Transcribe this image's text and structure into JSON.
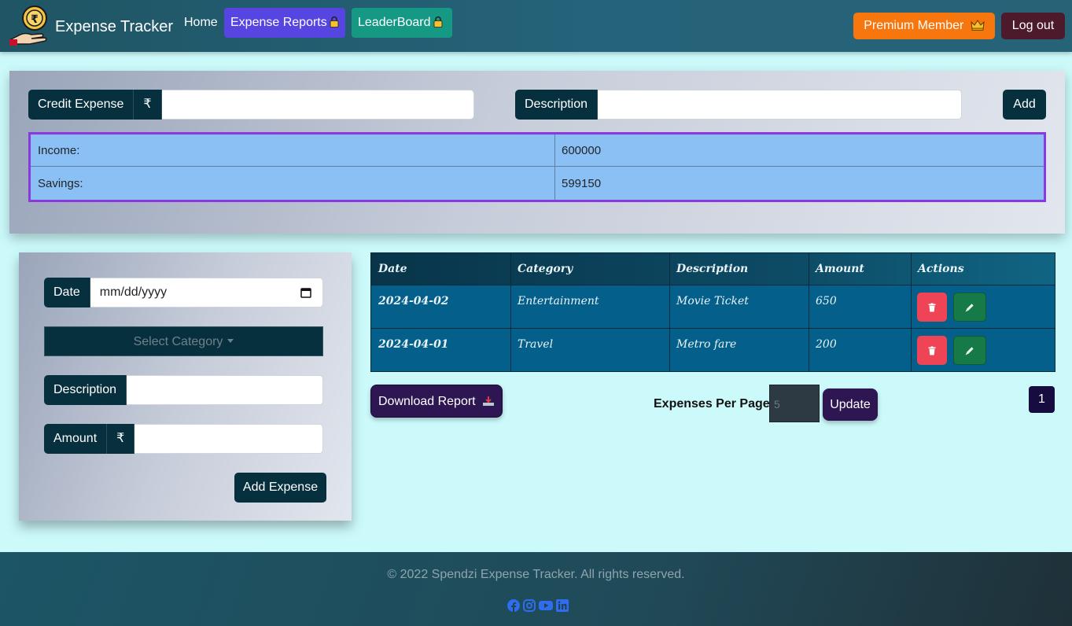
{
  "navbar": {
    "brand": "Expense Tracker",
    "links": {
      "home": "Home",
      "reports": "Expense Reports",
      "leaderboard": "LeaderBoard"
    },
    "premium": "Premium Member",
    "logout": "Log out"
  },
  "credit": {
    "amount_label": "Credit Expense",
    "currency": "₹",
    "description_label": "Description",
    "add_label": "Add"
  },
  "summary": {
    "rows": [
      {
        "label": "Income:",
        "value": "600000"
      },
      {
        "label": "Savings:",
        "value": "599150"
      }
    ]
  },
  "expense_form": {
    "date_label": "Date",
    "date_placeholder": "mm/dd/yyyy",
    "category_placeholder": "Select Category",
    "description_label": "Description",
    "amount_label": "Amount",
    "currency": "₹",
    "submit_label": "Add Expense"
  },
  "expenses_table": {
    "headers": [
      "Date",
      "Category",
      "Description",
      "Amount",
      "Actions"
    ],
    "rows": [
      {
        "date": "2024-04-02",
        "category": "Entertainment",
        "description": "Movie Ticket",
        "amount": "650"
      },
      {
        "date": "2024-04-01",
        "category": "Travel",
        "description": "Metro fare",
        "amount": "200"
      }
    ]
  },
  "controls": {
    "download_label": "Download Report",
    "per_page_label": "Expenses Per Page:",
    "per_page_placeholder": "5",
    "update_label": "Update",
    "current_page": "1"
  },
  "footer": {
    "copyright": "© 2022 Spendzi Expense Tracker. All rights reserved.",
    "social_icons": [
      "facebook-icon",
      "instagram-icon",
      "youtube-icon",
      "linkedin-icon"
    ],
    "social_color": "#2f6cf0"
  },
  "colors": {
    "page_bg": "#ccfafb",
    "dark_teal": "#07303f",
    "premium_orange": "#f8760e",
    "reports_purple": "#5645e0",
    "leaderboard_teal": "#159984",
    "summary_blue": "#8bc0f5",
    "summary_border": "#8a38e0",
    "delete_red": "#ee4455",
    "edit_green": "#157a47"
  }
}
